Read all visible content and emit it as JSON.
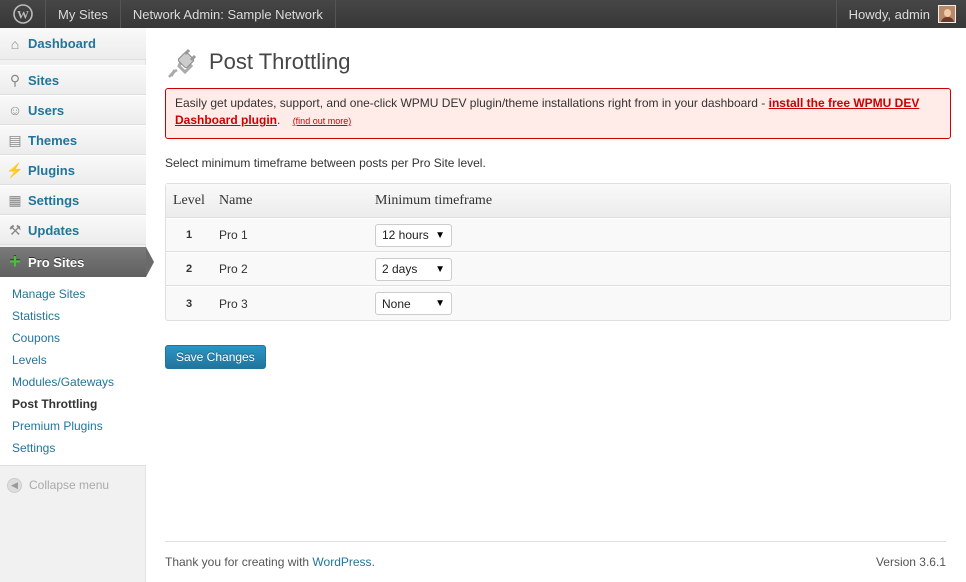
{
  "adminbar": {
    "my_sites": "My Sites",
    "network_admin": "Network Admin: Sample Network",
    "howdy": "Howdy, admin"
  },
  "sidebar": {
    "items": [
      {
        "label": "Dashboard",
        "icon": "home-icon"
      },
      {
        "label": "Sites",
        "icon": "sites-icon"
      },
      {
        "label": "Users",
        "icon": "users-icon"
      },
      {
        "label": "Themes",
        "icon": "themes-icon"
      },
      {
        "label": "Plugins",
        "icon": "plugins-icon"
      },
      {
        "label": "Settings",
        "icon": "settings-icon"
      },
      {
        "label": "Updates",
        "icon": "updates-icon"
      }
    ],
    "current": {
      "label": "Pro Sites",
      "icon": "plus-icon"
    },
    "submenu": [
      "Manage Sites",
      "Statistics",
      "Coupons",
      "Levels",
      "Modules/Gateways",
      "Post Throttling",
      "Premium Plugins",
      "Settings"
    ],
    "collapse": "Collapse menu"
  },
  "page": {
    "title": "Post Throttling",
    "notice": {
      "text": "Easily get updates, support, and one-click WPMU DEV plugin/theme installations right from in your dashboard -",
      "link": "install the free WPMU DEV Dashboard plugin",
      "suffix": ".",
      "small_link": "(find out more)"
    },
    "description": "Select minimum timeframe between posts per Pro Site level.",
    "table": {
      "headers": [
        "Level",
        "Name",
        "Minimum timeframe"
      ],
      "rows": [
        {
          "level": "1",
          "name": "Pro 1",
          "timeframe": "12 hours"
        },
        {
          "level": "2",
          "name": "Pro 2",
          "timeframe": "2 days"
        },
        {
          "level": "3",
          "name": "Pro 3",
          "timeframe": "None"
        }
      ]
    },
    "save_label": "Save Changes"
  },
  "footer": {
    "thanks": "Thank you for creating with",
    "wp_link": "WordPress",
    "period": ".",
    "version": "Version 3.6.1"
  },
  "colors": {
    "link": "#21759b",
    "notice_border": "#cc0000",
    "notice_bg": "#ffebe8",
    "button": "#21759b",
    "adminbar": "#464646"
  }
}
